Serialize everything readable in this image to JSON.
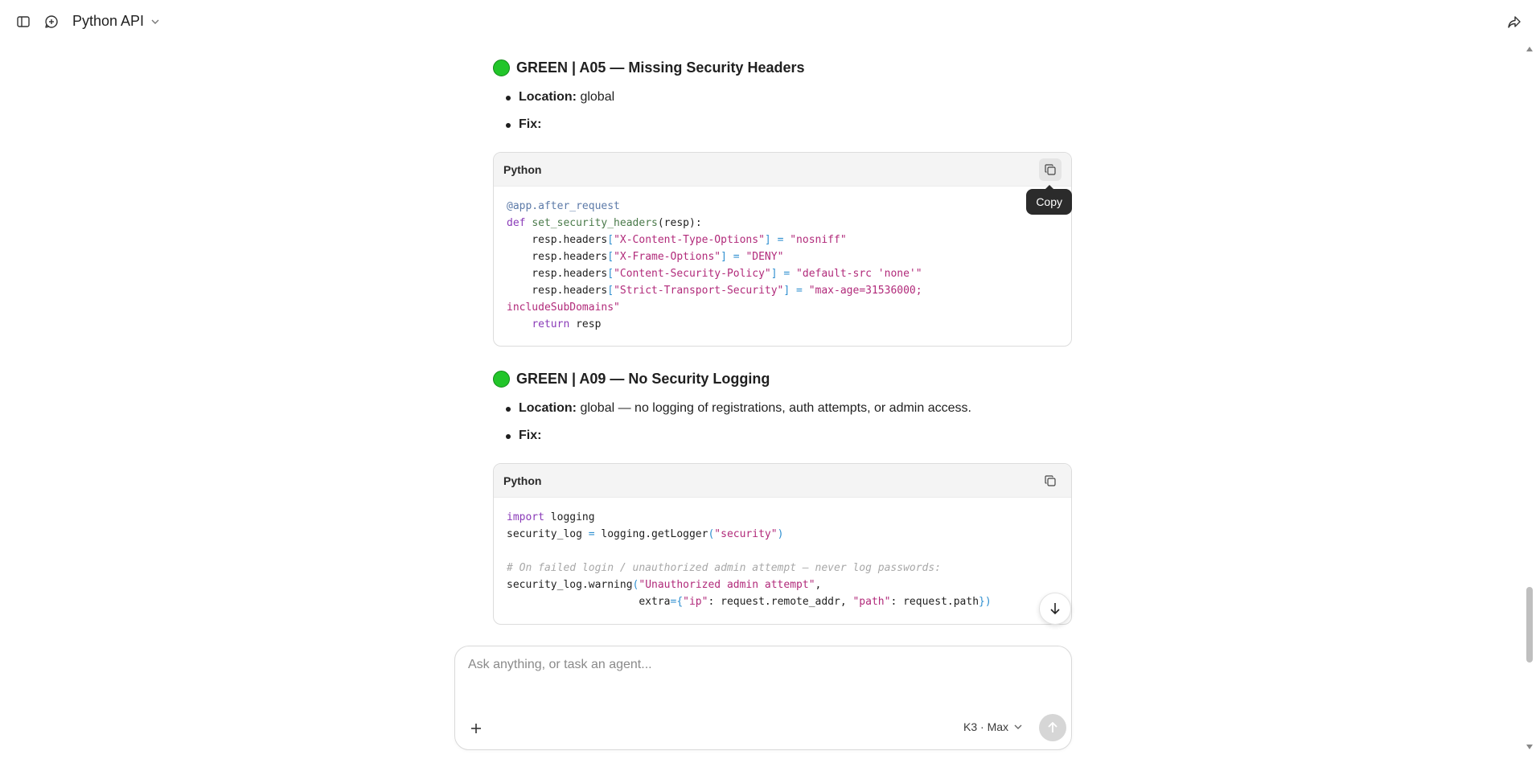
{
  "topbar": {
    "title": "Python API",
    "icons": [
      "sidebar-toggle-icon",
      "new-chat-icon",
      "chevron-down-icon",
      "share-icon"
    ]
  },
  "sections": [
    {
      "status": "GREEN",
      "heading": "GREEN | A05 — Missing Security Headers",
      "location_label": "Location:",
      "location_value": " global",
      "fix_label": "Fix:",
      "code_lang": "Python",
      "tooltip": "Copy"
    },
    {
      "status": "GREEN",
      "heading": "GREEN | A09 — No Security Logging",
      "location_label": "Location:",
      "location_value": " global — no logging of registrations, auth attempts, or admin access.",
      "fix_label": "Fix:",
      "code_lang": "Python"
    }
  ],
  "code1": {
    "l1": "@app.after_request",
    "l2_kw": "def",
    "l2_fn": "set_security_headers",
    "l2_rest": "(resp):",
    "l3_a": "    resp.headers",
    "l3_k": "\"X-Content-Type-Options\"",
    "l3_v": "\"nosniff\"",
    "l4_a": "    resp.headers",
    "l4_k": "\"X-Frame-Options\"",
    "l4_v": "\"DENY\"",
    "l5_a": "    resp.headers",
    "l5_k": "\"Content-Security-Policy\"",
    "l5_v": "\"default-src 'none'\"",
    "l6_a": "    resp.headers",
    "l6_k": "\"Strict-Transport-Security\"",
    "l6_v": "\"max-age=31536000;",
    "l7": "includeSubDomains\"",
    "l8_kw": "return",
    "l8_rest": " resp"
  },
  "code2": {
    "l1_kw": "import",
    "l1_rest": " logging",
    "l2_a": "security_log ",
    "l2_b": " logging.getLogger",
    "l2_s": "\"security\"",
    "l4": "# On failed login / unauthorized admin attempt — never log passwords:",
    "l5_a": "security_log.warning",
    "l5_s": "\"Unauthorized admin attempt\"",
    "l6_pad": "                     extra",
    "l6_k1": "\"ip\"",
    "l6_v1": " request.remote_addr, ",
    "l6_k2": "\"path\"",
    "l6_v2": " request.path"
  },
  "composer": {
    "placeholder": "Ask anything, or task an agent...",
    "model": "K3 · Max"
  }
}
